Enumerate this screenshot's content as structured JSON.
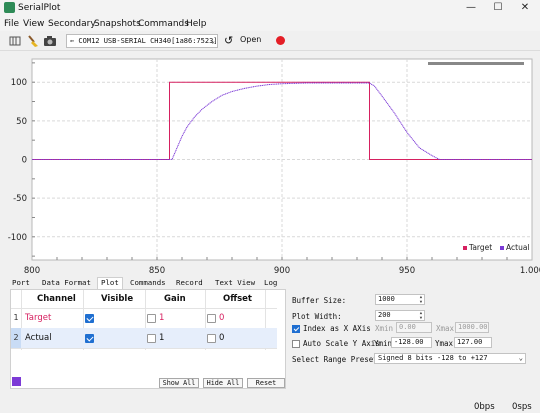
{
  "window": {
    "title": "SerialPlot",
    "minimize": "—",
    "maximize": "☐",
    "close": "✕"
  },
  "menu": [
    "File",
    "View",
    "Secondary",
    "Snapshots",
    "Commands",
    "Help"
  ],
  "toolbar": {
    "port_value": "⇐ COM12 USB-SERIAL CH340[1a86:7523]",
    "port_arrow": "⌄",
    "refresh_icon": "↺",
    "open_label": "Open",
    "icons": [
      "panel-icon",
      "clear-icon",
      "camera-icon"
    ],
    "record_color": "#e41e26"
  },
  "chart_data": {
    "type": "line",
    "xlim": [
      800,
      1000
    ],
    "ylim": [
      -130,
      130
    ],
    "x_ticks": [
      "800",
      "850",
      "900",
      "950",
      "1.000"
    ],
    "y_ticks": [
      "100",
      "50",
      "0",
      "-50",
      "-100"
    ],
    "y_tick_values": [
      100,
      50,
      0,
      -50,
      -100
    ],
    "x_tick_values": [
      800,
      850,
      900,
      950,
      1000
    ],
    "grid": true,
    "legend_position": "bottom-right",
    "series": [
      {
        "name": "Target",
        "color": "#d62060",
        "x": [
          800,
          855,
          855,
          935,
          935,
          1000
        ],
        "y": [
          0,
          0,
          100,
          100,
          0,
          0
        ]
      },
      {
        "name": "Actual",
        "color": "#7c3ad6",
        "x": [
          800,
          856,
          858,
          860,
          862,
          865,
          868,
          872,
          876,
          880,
          885,
          890,
          895,
          900,
          910,
          920,
          930,
          935,
          937,
          940,
          945,
          950,
          955,
          960,
          963,
          1000
        ],
        "y": [
          0,
          0,
          15,
          30,
          42,
          55,
          65,
          75,
          83,
          88,
          92,
          95,
          97,
          98,
          99,
          99,
          99,
          99,
          95,
          82,
          60,
          35,
          15,
          5,
          0,
          0
        ]
      }
    ]
  },
  "channels": {
    "headers": [
      "Channel",
      "Visible",
      "Gain",
      "Offset"
    ],
    "rows": [
      {
        "num": "1",
        "name": "Target",
        "visible": true,
        "gain": "1",
        "offset": "0",
        "color": "#d62060"
      },
      {
        "num": "2",
        "name": "Actual",
        "visible": true,
        "gain": "1",
        "offset": "0",
        "color": "#111111"
      }
    ],
    "swatch_color": "#7c3ad6",
    "buttons": [
      "Show All",
      "Hide All",
      "Reset"
    ]
  },
  "tabs": [
    "Port",
    "Data Format",
    "Plot",
    "Commands",
    "Record",
    "Text View",
    "Log"
  ],
  "active_tab": "Plot",
  "plot_settings": {
    "buffer_size_label": "Buffer Size:",
    "buffer_size": "1000",
    "plot_width_label": "Plot Width:",
    "plot_width": "200",
    "index_as_x_label": "Index as X AXis",
    "index_as_x": true,
    "xmin_label": "Xmin",
    "xmin": "0.00",
    "xmax_label": "Xmax",
    "xmax": "1000.00",
    "auto_scale_label": "Auto Scale Y Axis",
    "auto_scale": false,
    "ymin_label": "Ymin",
    "ymin": "-128.00",
    "ymax_label": "Ymax",
    "ymax": "127.00",
    "range_preset_label": "Select Range Preset:",
    "range_preset": "Signed 8 bits -128 to +127"
  },
  "status": {
    "rx_rate": "0bps",
    "tx_rate": "0sps"
  }
}
